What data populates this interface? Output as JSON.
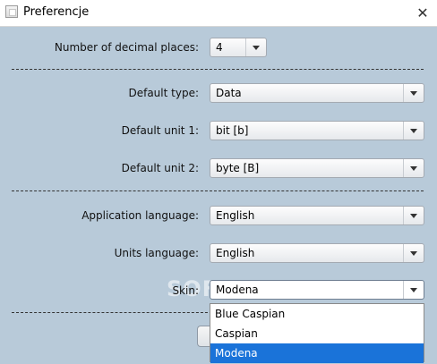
{
  "window": {
    "title": "Preferencje",
    "close_glyph": "✕"
  },
  "icons": {
    "app": "app-icon",
    "close": "close-icon",
    "dropdown": "chevron-down-icon"
  },
  "form": {
    "decimal_places": {
      "label": "Number of decimal places:",
      "value": "4"
    },
    "default_type": {
      "label": "Default type:",
      "value": "Data"
    },
    "default_unit_1": {
      "label": "Default unit 1:",
      "value": "bit [b]"
    },
    "default_unit_2": {
      "label": "Default unit 2:",
      "value": "byte [B]"
    },
    "application_language": {
      "label": "Application language:",
      "value": "English"
    },
    "units_language": {
      "label": "Units language:",
      "value": "English"
    },
    "skin": {
      "label": "Skin:",
      "value": "Modena",
      "options": [
        "Blue Caspian",
        "Caspian",
        "Modena"
      ],
      "selected_index": 2
    }
  },
  "watermark": "SOFTPEDIA",
  "colors": {
    "background": "#b8cad9",
    "selection": "#1a73d9"
  }
}
